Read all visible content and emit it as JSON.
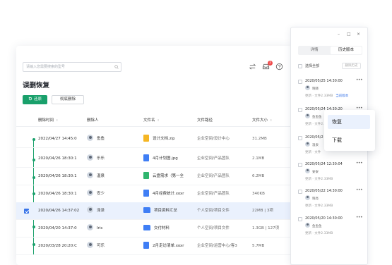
{
  "search": {
    "placeholder": "请输入您需要搜索的型号"
  },
  "header": {
    "notification_count": "2"
  },
  "page": {
    "title": "误删恢复"
  },
  "toolbar": {
    "restore_label": "还原",
    "delete_label": "彻底删除"
  },
  "table": {
    "columns": [
      "删除时间",
      "删除人",
      "文件名",
      "文件路径",
      "文件大小"
    ],
    "rows": [
      {
        "time": "2022/04/27 14:45:0",
        "user": "鱼鱼",
        "file": "设计文档.zip",
        "file_type": "zip",
        "path": "企业空间/设计中心",
        "size": "31.2MB",
        "selected": false
      },
      {
        "time": "2020/04/26 18:30:1",
        "user": "乐乐",
        "file": "4月计划图.jpg",
        "file_type": "img",
        "path": "企业空间/产品团队",
        "size": "2.1MB",
        "selected": false
      },
      {
        "time": "2020/04/26 18:30:1",
        "user": "温泉",
        "file": "云盘需求（第一全",
        "file_type": "sheet",
        "path": "企业空间/产品团队",
        "size": "6.2MB",
        "selected": false
      },
      {
        "time": "2020/04/26 18:30:1",
        "user": "安少",
        "file": "4月经费统计.xoxr",
        "file_type": "excel",
        "path": "企业空间/产品团队",
        "size": "340KB",
        "selected": false
      },
      {
        "time": "2020/04/26 14:37:02",
        "user": "泽泽",
        "file": "项目资料汇总",
        "file_type": "folder",
        "path": "个人空间/项目文件",
        "size": "22MB | 3项",
        "selected": true
      },
      {
        "time": "2020/04/20 14:37:0",
        "user": "Iris",
        "file": "交付材料",
        "file_type": "folder",
        "path": "个人空间/项目文件",
        "size": "1.3GB | 127项",
        "selected": false
      },
      {
        "time": "2020/03/28 20:20:C",
        "user": "可乐",
        "file": "2月走访清单.xoxr",
        "file_type": "doc",
        "path": "企业空间/运营中心/客3",
        "size": "5.7MB",
        "selected": false
      }
    ]
  },
  "side_panel": {
    "tabs": [
      "详情",
      "历史版本"
    ],
    "active_tab": "历史版本",
    "select_all_label": "选择全部",
    "delete_versions_label": "删除历史",
    "versions": [
      {
        "time": "2020/05/25 14:30:00",
        "user": "晓晓",
        "meta": "更新 · 文件2.33MB",
        "current_label": "当前版本"
      },
      {
        "time": "2020/05/24 14:30:20",
        "user": "鱼鱼鱼",
        "meta": "更新 · 文件2.33MB",
        "current_label": ""
      },
      {
        "time": "2020/05/2",
        "user": "温泉",
        "meta": "更新 · 文件",
        "current_label": ""
      },
      {
        "time": "2020/05/24 12:30:04",
        "user": "安安",
        "meta": "更新 · 文件2.33MB",
        "current_label": ""
      },
      {
        "time": "2020/05/22 14:30:00",
        "user": "晓亮",
        "meta": "更新 · 文件2.33MB",
        "current_label": ""
      },
      {
        "time": "2020/05/20 14:30:00",
        "user": "鱼鱼鱼",
        "meta": "更新 · 文件2.33MB",
        "current_label": ""
      }
    ]
  },
  "context_menu": {
    "items": [
      "恢复",
      "下载"
    ],
    "active": "恢复"
  },
  "colors": {
    "accent_green": "#19a06b",
    "accent_blue": "#3a75e8",
    "badge_red": "#f04a4a"
  },
  "icons": [
    "search-icon",
    "swap-icon",
    "inbox-icon",
    "help-icon",
    "restore-icon",
    "minimize-icon",
    "maximize-icon",
    "close-icon",
    "more-icon"
  ]
}
